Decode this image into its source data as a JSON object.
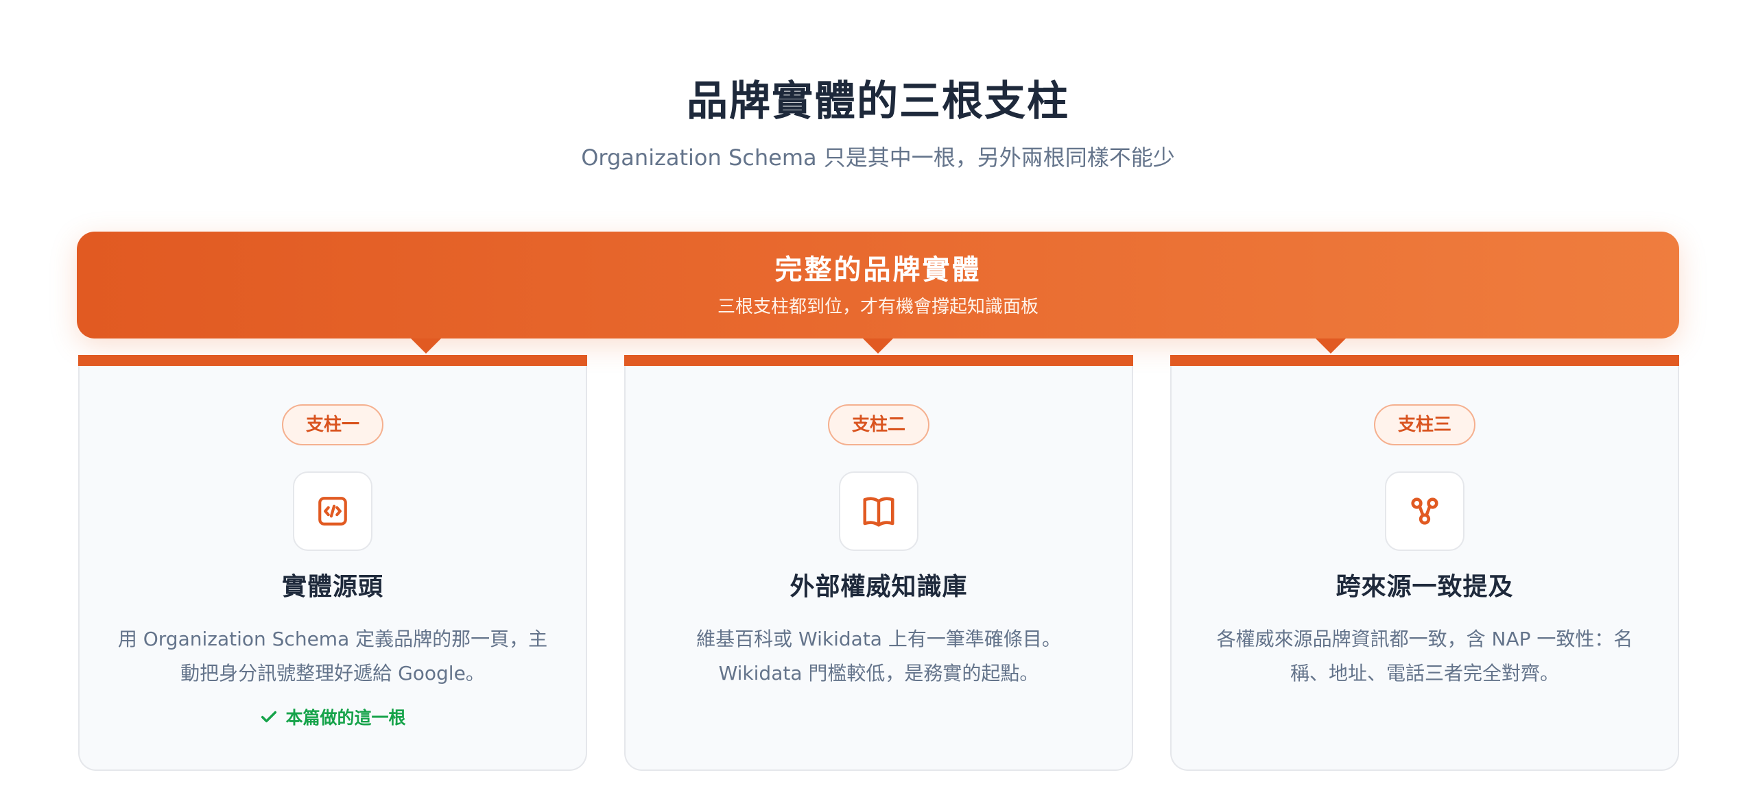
{
  "header": {
    "title": "品牌實體的三根支柱",
    "subtitle": "Organization Schema 只是其中一根，另外兩根同樣不能少"
  },
  "banner": {
    "title": "完整的品牌實體",
    "subtitle": "三根支柱都到位，才有機會撐起知識面板"
  },
  "colors": {
    "accent": "#e15a22",
    "check": "#16a34a",
    "title": "#1e293b",
    "muted": "#64748b"
  },
  "pillars": [
    {
      "badge": "支柱一",
      "icon": "code-icon",
      "title": "實體源頭",
      "description": "用 Organization Schema 定義品牌的那一頁，主動把身分訊號整理好遞給 Google。",
      "note": "本篇做的這一根"
    },
    {
      "badge": "支柱二",
      "icon": "book-open-icon",
      "title": "外部權威知識庫",
      "description": "維基百科或 Wikidata 上有一筆準確條目。Wikidata 門檻較低，是務實的起點。"
    },
    {
      "badge": "支柱三",
      "icon": "share-nodes-icon",
      "title": "跨來源一致提及",
      "description": "各權威來源品牌資訊都一致，含 NAP 一致性：名稱、地址、電話三者完全對齊。"
    }
  ]
}
